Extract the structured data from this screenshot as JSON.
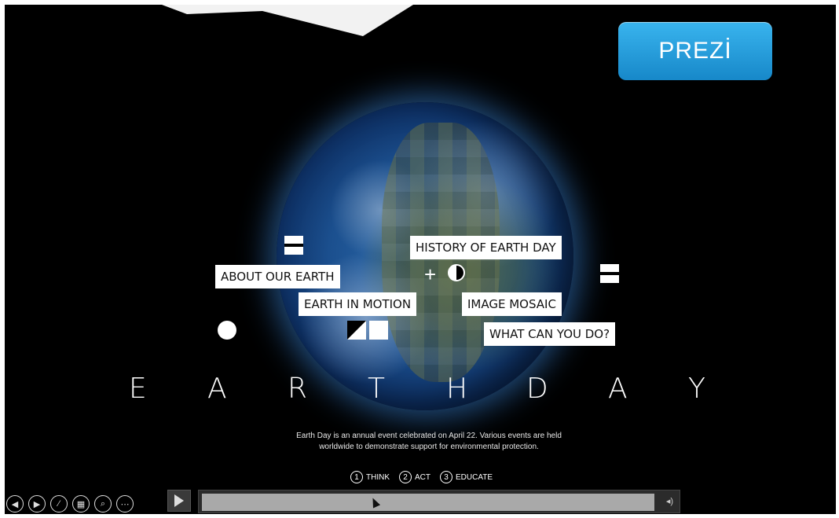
{
  "brand_button": {
    "label": "PREZİ",
    "color": "#2aa3e0"
  },
  "topics": {
    "about": "ABOUT OUR EARTH",
    "history": "HISTORY OF EARTH DAY",
    "motion": "EARTH IN MOTION",
    "mosaic": "IMAGE MOSAIC",
    "what": "WHAT CAN YOU DO?"
  },
  "title_letters": [
    "E",
    "A",
    "R",
    "T",
    "H",
    "D",
    "A",
    "Y"
  ],
  "description": "Earth Day is an annual event celebrated on April 22. Various events are held worldwide to demonstrate support for environmental protection.",
  "steps": [
    {
      "num": "1",
      "label": "THINK"
    },
    {
      "num": "2",
      "label": "ACT"
    },
    {
      "num": "3",
      "label": "EDUCATE"
    }
  ],
  "controls": {
    "icons": [
      "prev-icon",
      "next-icon",
      "pen-icon",
      "slides-icon",
      "zoom-icon",
      "more-icon"
    ],
    "icon_glyphs": [
      "◀",
      "▶",
      "⁄",
      "▦",
      "⌕",
      "⋯"
    ],
    "volume_glyph": "◂)"
  }
}
